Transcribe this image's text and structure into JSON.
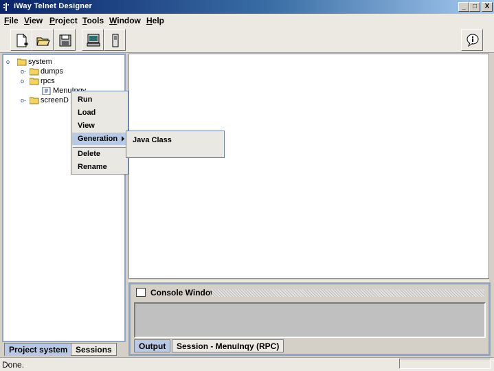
{
  "window": {
    "title": "iWay Telnet Designer",
    "minimize": "_",
    "maximize": "□",
    "close": "X"
  },
  "menubar": {
    "items": [
      {
        "label": "File",
        "u": "F",
        "rest": "ile"
      },
      {
        "label": "View",
        "u": "V",
        "rest": "iew"
      },
      {
        "label": "Project",
        "u": "P",
        "rest": "roject"
      },
      {
        "label": "Tools",
        "u": "T",
        "rest": "ools"
      },
      {
        "label": "Window",
        "u": "W",
        "rest": "indow"
      },
      {
        "label": "Help",
        "u": "H",
        "rest": "elp"
      }
    ]
  },
  "toolbar": {
    "buttons": [
      "new-file-icon",
      "open-folder-icon",
      "save-disk-icon",
      "monitor-icon",
      "device-icon"
    ],
    "help": "info-bubble-icon"
  },
  "tree": {
    "root": "system",
    "items": [
      {
        "label": "dumps"
      },
      {
        "label": "rpcs"
      },
      {
        "label": "MenuInqy"
      },
      {
        "label": "screenD"
      }
    ]
  },
  "left_tabs": {
    "project": "Project system",
    "sessions": "Sessions"
  },
  "context_menu": {
    "run": "Run",
    "load": "Load",
    "view": "View",
    "generation": "Generation",
    "delete": "Delete",
    "rename": "Rename"
  },
  "submenu": {
    "java_class": "Java Class"
  },
  "console": {
    "title": "Console Window",
    "tab_output": "Output",
    "tab_session": "Session - MenuInqy (RPC)"
  },
  "status": {
    "text": "Done."
  },
  "colors": {
    "accent": "#b7c9e4",
    "title_start": "#0a246a",
    "panel_border": "#8fa6c8"
  }
}
